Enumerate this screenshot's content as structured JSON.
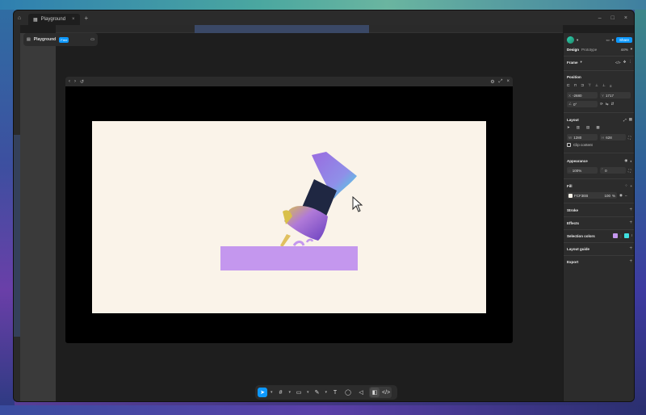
{
  "titlebar": {
    "tab_label": "Playground",
    "tab_close": "×",
    "new_tab": "+",
    "window_controls": [
      "–",
      "□",
      "×"
    ]
  },
  "file": {
    "name": "Playground",
    "plan_badge": "Free"
  },
  "panel": {
    "share_label": "Share",
    "tabs": [
      "Design",
      "Prototype"
    ],
    "zoom": "44%",
    "frame_label": "Frame",
    "position_title": "Position",
    "x": "-2680",
    "y": "1717",
    "rotation": "0°",
    "layout_title": "Layout",
    "width": "1280",
    "height": "628",
    "clip_content_label": "Clip content",
    "appearance_title": "Appearance",
    "opacity": "100%",
    "radius": "0",
    "fill_title": "Fill",
    "fill_hex": "FCF3EB",
    "fill_opacity": "100",
    "stroke_title": "Stroke",
    "effects_title": "Effects",
    "selection_colors_title": "Selection colors",
    "layout_guide_title": "Layout guide",
    "export_title": "Export"
  },
  "colors": {
    "accent": "#0d99ff",
    "artboard_bg": "#faf3e9",
    "purple_block": "#c497ee",
    "selection_color_1": "#c497ee",
    "selection_color_2": "#3fe0e0"
  },
  "toolbar": {
    "tools": [
      "move-tool",
      "frame-tool",
      "shape-tool",
      "pen-tool",
      "text-tool",
      "comment-tool",
      "actions-tool"
    ]
  },
  "help_label": "?"
}
